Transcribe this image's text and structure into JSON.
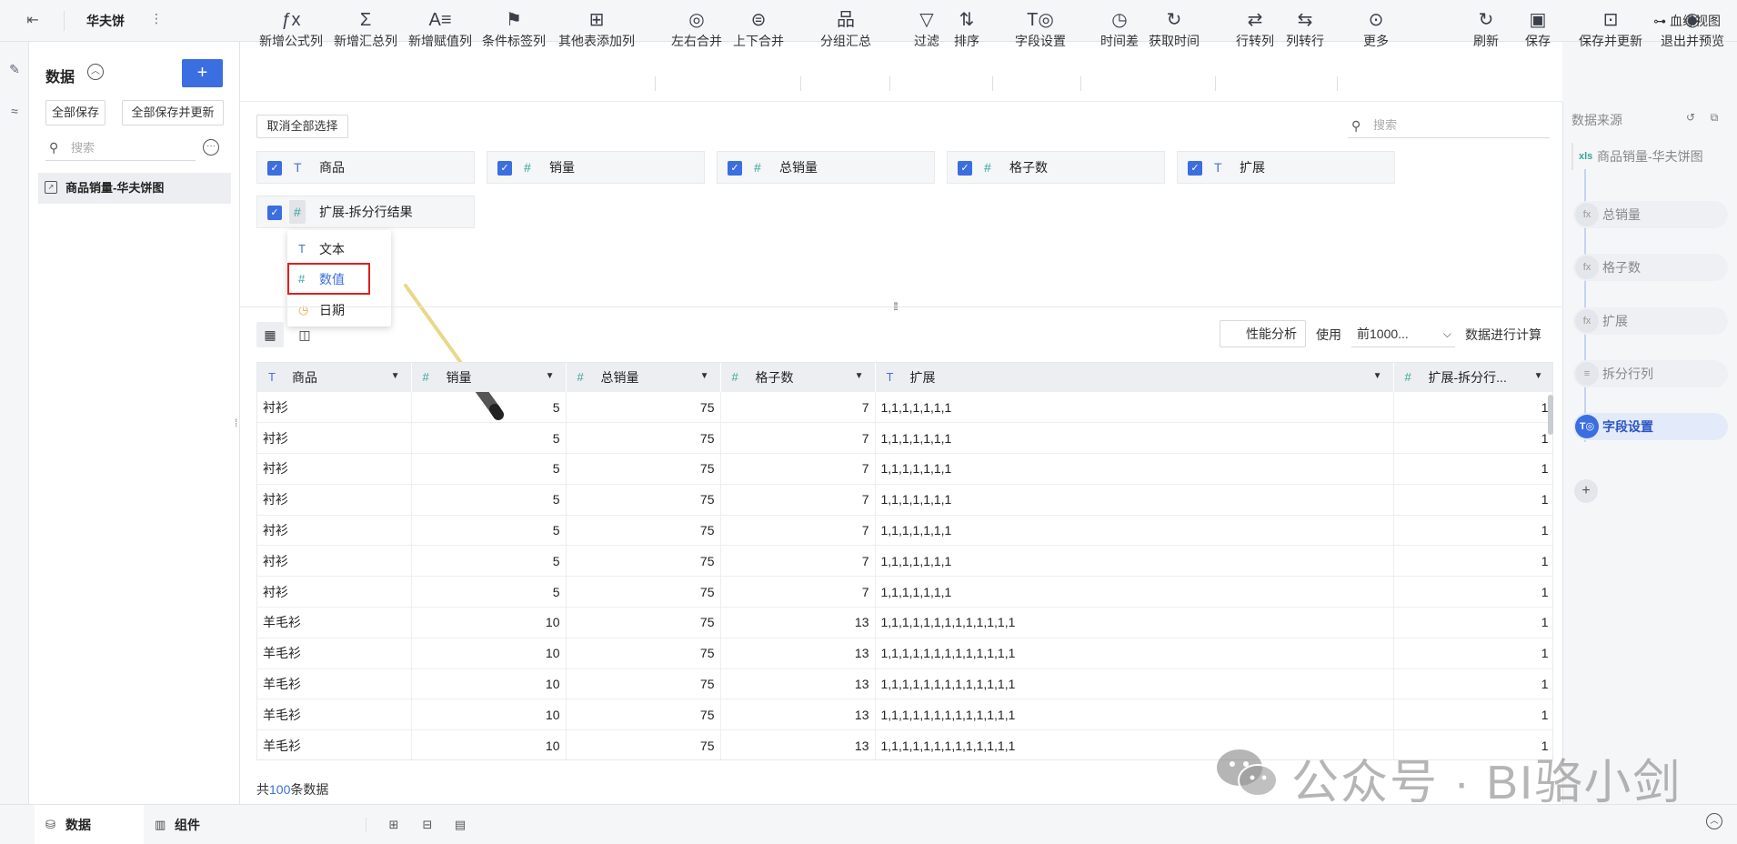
{
  "topbar": {
    "back_icon": "exit-icon",
    "title": "华夫饼",
    "lineage_label": "血缘视图"
  },
  "data_panel": {
    "header": "数据",
    "save_all": "全部保存",
    "save_all_update": "全部保存并更新",
    "search_placeholder": "搜索",
    "items": [
      {
        "label": "商品销量-华夫饼图"
      }
    ]
  },
  "toolbar": {
    "tools": [
      {
        "label": "新增公式列",
        "icon": "fx-icon"
      },
      {
        "label": "新增汇总列",
        "icon": "sigma-icon"
      },
      {
        "label": "新增赋值列",
        "icon": "assign-icon"
      },
      {
        "label": "条件标签列",
        "icon": "flag-icon"
      },
      {
        "label": "其他表添加列",
        "icon": "add-column-icon"
      },
      {
        "label": "左右合并",
        "icon": "merge-horizontal-icon"
      },
      {
        "label": "上下合并",
        "icon": "merge-vertical-icon"
      },
      {
        "label": "分组汇总",
        "icon": "group-icon"
      },
      {
        "label": "过滤",
        "icon": "filter-icon"
      },
      {
        "label": "排序",
        "icon": "sort-icon"
      },
      {
        "label": "字段设置",
        "icon": "field-settings-icon"
      },
      {
        "label": "时间差",
        "icon": "clock-icon"
      },
      {
        "label": "获取时间",
        "icon": "clock-refresh-icon"
      },
      {
        "label": "行转列",
        "icon": "row-to-col-icon"
      },
      {
        "label": "列转行",
        "icon": "col-to-row-icon"
      },
      {
        "label": "更多",
        "icon": "more-icon"
      },
      {
        "label": "刷新",
        "icon": "refresh-icon"
      },
      {
        "label": "保存",
        "icon": "save-icon"
      },
      {
        "label": "保存并更新",
        "icon": "save-update-icon"
      },
      {
        "label": "退出并预览",
        "icon": "preview-icon"
      }
    ]
  },
  "field_config": {
    "cancel_all": "取消全部选择",
    "search_placeholder": "搜索",
    "fields": [
      {
        "type": "T",
        "name": "商品"
      },
      {
        "type": "#",
        "name": "销量"
      },
      {
        "type": "#",
        "name": "总销量"
      },
      {
        "type": "#",
        "name": "格子数"
      },
      {
        "type": "T",
        "name": "扩展"
      },
      {
        "type": "#",
        "name": "扩展-拆分行结果"
      }
    ],
    "type_menu": [
      {
        "icon": "T",
        "label": "文本"
      },
      {
        "icon": "#",
        "label": "数值"
      },
      {
        "icon": "◷",
        "label": "日期"
      }
    ]
  },
  "preview": {
    "perf_label": "性能分析",
    "use_label": "使用",
    "use_value": "前1000...",
    "calc_label": "数据进行计算",
    "columns": [
      {
        "type": "T",
        "name": "商品"
      },
      {
        "type": "#",
        "name": "销量"
      },
      {
        "type": "#",
        "name": "总销量"
      },
      {
        "type": "#",
        "name": "格子数"
      },
      {
        "type": "T",
        "name": "扩展"
      },
      {
        "type": "#",
        "name": "扩展-拆分行..."
      }
    ],
    "rows": [
      [
        "衬衫",
        "5",
        "75",
        "7",
        "1,1,1,1,1,1,1",
        "1"
      ],
      [
        "衬衫",
        "5",
        "75",
        "7",
        "1,1,1,1,1,1,1",
        "1"
      ],
      [
        "衬衫",
        "5",
        "75",
        "7",
        "1,1,1,1,1,1,1",
        "1"
      ],
      [
        "衬衫",
        "5",
        "75",
        "7",
        "1,1,1,1,1,1,1",
        "1"
      ],
      [
        "衬衫",
        "5",
        "75",
        "7",
        "1,1,1,1,1,1,1",
        "1"
      ],
      [
        "衬衫",
        "5",
        "75",
        "7",
        "1,1,1,1,1,1,1",
        "1"
      ],
      [
        "衬衫",
        "5",
        "75",
        "7",
        "1,1,1,1,1,1,1",
        "1"
      ],
      [
        "羊毛衫",
        "10",
        "75",
        "13",
        "1,1,1,1,1,1,1,1,1,1,1,1,1",
        "1"
      ],
      [
        "羊毛衫",
        "10",
        "75",
        "13",
        "1,1,1,1,1,1,1,1,1,1,1,1,1",
        "1"
      ],
      [
        "羊毛衫",
        "10",
        "75",
        "13",
        "1,1,1,1,1,1,1,1,1,1,1,1,1",
        "1"
      ],
      [
        "羊毛衫",
        "10",
        "75",
        "13",
        "1,1,1,1,1,1,1,1,1,1,1,1,1",
        "1"
      ],
      [
        "羊毛衫",
        "10",
        "75",
        "13",
        "1,1,1,1,1,1,1,1,1,1,1,1,1",
        "1"
      ]
    ],
    "total_prefix": "共",
    "total_count": "100",
    "total_suffix": "条数据"
  },
  "right_panel": {
    "title": "数据来源",
    "source": "商品销量-华夫饼图",
    "steps": [
      {
        "icon": "fx",
        "label": "总销量",
        "active": false
      },
      {
        "icon": "fx",
        "label": "格子数",
        "active": false
      },
      {
        "icon": "fx",
        "label": "扩展",
        "active": false
      },
      {
        "icon": "≡",
        "label": "拆分行列",
        "active": false
      },
      {
        "icon": "T◎",
        "label": "字段设置",
        "active": true
      }
    ]
  },
  "bottombar": {
    "tab_data": "数据",
    "tab_component": "组件"
  },
  "watermark": "公众号 · BI骆小剑",
  "colors": {
    "accent": "#3b6ee0",
    "number_type": "#3aa59a",
    "highlight": "#e02020"
  }
}
